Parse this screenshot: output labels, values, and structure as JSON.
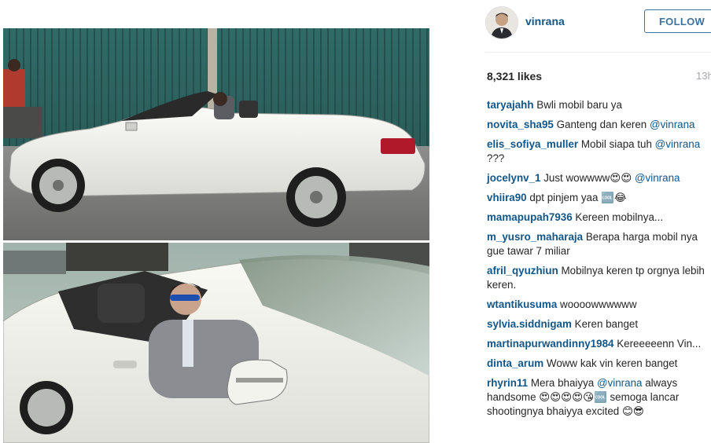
{
  "post": {
    "username": "vinrana",
    "follow_label": "FOLLOW",
    "likes": "8,321 likes",
    "timestamp": "13h"
  },
  "comments": [
    {
      "user": "taryajahh",
      "text": "Bwli mobil baru ya",
      "mention": "",
      "after": ""
    },
    {
      "user": "novita_sha95",
      "text": "Ganteng dan keren",
      "mention": "@vinrana",
      "after": ""
    },
    {
      "user": "elis_sofiya_muller",
      "text": "Mobil siapa tuh",
      "mention": "@vinrana",
      "after": " ???"
    },
    {
      "user": "jocelynv_1",
      "text": "Just wowwww😍😍",
      "mention": "@vinrana",
      "after": ""
    },
    {
      "user": "vhiira90",
      "text": "dpt pinjem yaa 🆒😂",
      "mention": "",
      "after": ""
    },
    {
      "user": "mamapupah7936",
      "text": "Kereen mobilnya...",
      "mention": "",
      "after": ""
    },
    {
      "user": "m_yusro_maharaja",
      "text": "Berapa harga mobil nya gue tawar 7 miliar",
      "mention": "",
      "after": ""
    },
    {
      "user": "afril_qyuzhiun",
      "text": "Mobilnya keren tp orgnya lebih keren.",
      "mention": "",
      "after": ""
    },
    {
      "user": "wtantikusuma",
      "text": "woooowwwwww",
      "mention": "",
      "after": ""
    },
    {
      "user": "sylvia.siddnigam",
      "text": "Keren banget",
      "mention": "",
      "after": ""
    },
    {
      "user": "martinapurwandinny1984",
      "text": "Kereeeeenn Vin...",
      "mention": "",
      "after": ""
    },
    {
      "user": "dinta_arum",
      "text": "Woww kak vin keren banget",
      "mention": "",
      "after": ""
    },
    {
      "user": "rhyrin11",
      "text": "Mera bhaiyya",
      "mention": "@vinrana",
      "after": " always handsome 😍😍😍😍😘🆒 semoga lancar shootingnya bhaiyya excited 😊😎"
    }
  ],
  "colors": {
    "link": "#125688",
    "follow_border": "#3f729b",
    "muted": "#a5a7aa"
  }
}
